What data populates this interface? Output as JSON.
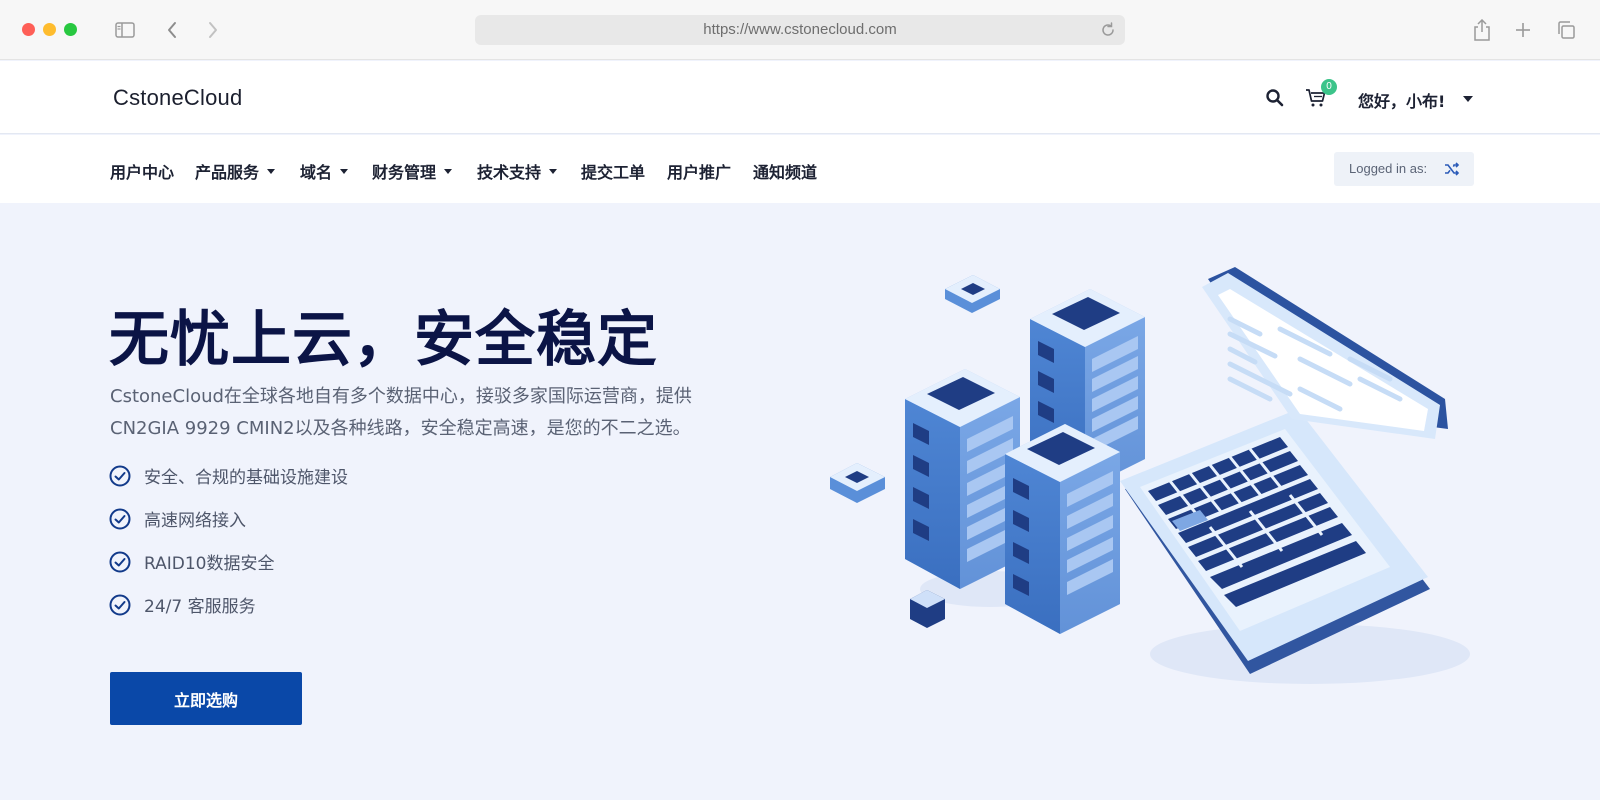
{
  "browser": {
    "url": "https://www.cstonecloud.com",
    "icons": [
      "sidebar-icon",
      "back-icon",
      "forward-icon",
      "reload-icon",
      "share-icon",
      "new-tab-icon",
      "tabs-icon"
    ]
  },
  "header": {
    "brand": "CstoneCloud",
    "cart_count": "0",
    "greeting": "您好，小布!"
  },
  "nav": {
    "items": [
      {
        "label": "用户中心",
        "dropdown": false
      },
      {
        "label": "产品服务",
        "dropdown": true
      },
      {
        "label": "域名",
        "dropdown": true
      },
      {
        "label": "财务管理",
        "dropdown": true
      },
      {
        "label": "技术支持",
        "dropdown": true
      },
      {
        "label": "提交工单",
        "dropdown": false
      },
      {
        "label": "用户推广",
        "dropdown": false
      },
      {
        "label": "通知频道",
        "dropdown": false
      }
    ],
    "logged_in_label": "Logged in as:"
  },
  "hero": {
    "title": "无忧上云，安全稳定",
    "description_line1": "CstoneCloud在全球各地自有多个数据中心，接驳多家国际运营商，提供",
    "description_line2": "CN2GIA 9929 CMIN2以及各种线路，安全稳定高速，是您的不二之选。",
    "features": [
      "安全、合规的基础设施建设",
      "高速网络接入",
      "RAID10数据安全",
      "24/7 客服服务"
    ],
    "cta_label": "立即选购"
  },
  "colors": {
    "primary": "#0a48a8",
    "title": "#0b1446",
    "badge": "#3cc48a",
    "hero_bg": "#f0f3fc"
  }
}
